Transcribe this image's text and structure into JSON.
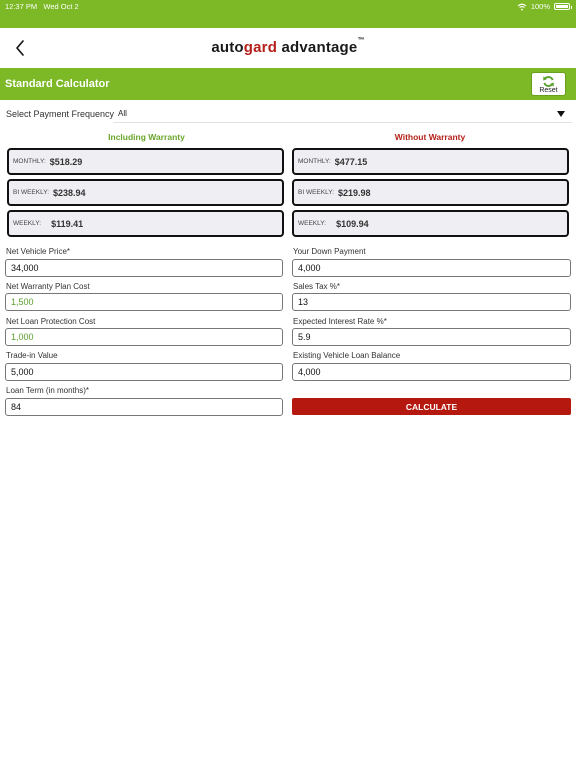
{
  "status_bar": {
    "time": "12:37 PM",
    "date": "Wed Oct 2",
    "battery": "100%"
  },
  "header": {
    "logo_part1": "auto",
    "logo_part2": "gard",
    "logo_part3": " advantage",
    "logo_tm": "™"
  },
  "title_bar": {
    "title": "Standard Calculator",
    "reset_label": "Reset"
  },
  "frequency": {
    "label": "Select Payment Frequency",
    "selected": "All"
  },
  "columns": {
    "including": {
      "heading": "Including Warranty",
      "monthly_key": "MONTHLY:",
      "monthly": "$518.29",
      "biweekly_key": "BI WEEKLY:",
      "biweekly": "$238.94",
      "weekly_key": "WEEKLY:",
      "weekly": "$119.41"
    },
    "excluding": {
      "heading": "Without Warranty",
      "monthly_key": "MONTHLY:",
      "monthly": "$477.15",
      "biweekly_key": "BI WEEKLY:",
      "biweekly": "$219.98",
      "weekly_key": "WEEKLY:",
      "weekly": "$109.94"
    }
  },
  "fields": {
    "vehicle_price": {
      "label": "Net Vehicle Price*",
      "value": "34,000"
    },
    "down_payment": {
      "label": "Your Down Payment",
      "value": "4,000"
    },
    "warranty_cost": {
      "label": "Net Warranty Plan Cost",
      "value": "1,500"
    },
    "sales_tax": {
      "label": "Sales Tax %*",
      "value": "13"
    },
    "loan_protection": {
      "label": "Net Loan Protection Cost",
      "value": "1,000"
    },
    "interest_rate": {
      "label": "Expected Interest Rate %*",
      "value": "5.9"
    },
    "trade_in": {
      "label": "Trade-in Value",
      "value": "5,000"
    },
    "existing_loan": {
      "label": "Existing Vehicle Loan Balance",
      "value": "4,000"
    },
    "loan_term": {
      "label": "Loan Term (in months)*",
      "value": "84"
    }
  },
  "calculate_label": "CALCULATE",
  "colors": {
    "brand_green": "#7db827",
    "brand_red": "#b5211a",
    "calc_red": "#b5180e",
    "green_text": "#5aa02c"
  }
}
